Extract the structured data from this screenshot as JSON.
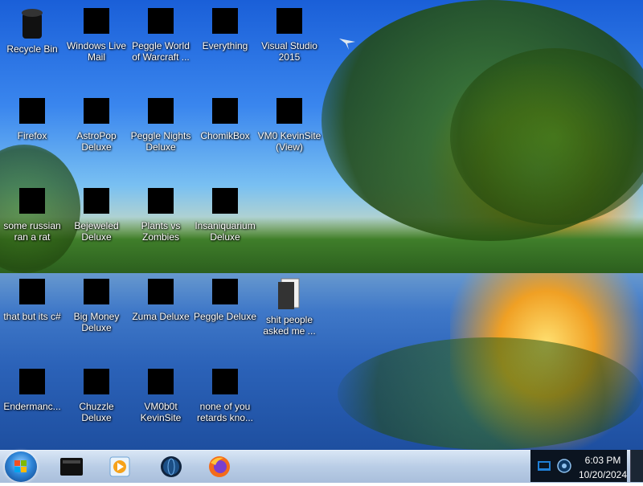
{
  "desktop": {
    "icons": [
      {
        "label": "Recycle Bin",
        "icon": "recycle-bin-icon"
      },
      {
        "label": "Windows Live\nMail",
        "icon": "mail-icon"
      },
      {
        "label": "Peggle World\nof Warcraft ...",
        "icon": "peggle-icon"
      },
      {
        "label": "Everything",
        "icon": "search-app-icon"
      },
      {
        "label": "Visual Studio\n2015",
        "icon": "visual-studio-icon"
      },
      {
        "label": "Firefox",
        "icon": "firefox-icon"
      },
      {
        "label": "AstroPop\nDeluxe",
        "icon": "game-icon"
      },
      {
        "label": "Peggle Nights\nDeluxe",
        "icon": "peggle-icon"
      },
      {
        "label": "ChomikBox",
        "icon": "chomikbox-icon"
      },
      {
        "label": "VM0 KevinSite\n(View)",
        "icon": "document-icon"
      },
      {
        "label": "some russian\nran a rat",
        "icon": "app-icon"
      },
      {
        "label": "Bejeweled\nDeluxe",
        "icon": "gem-icon"
      },
      {
        "label": "Plants vs\nZombies",
        "icon": "plant-icon"
      },
      {
        "label": "Insaniquarium\nDeluxe",
        "icon": "fish-icon"
      },
      {
        "label": "that but its c#",
        "icon": "files-icon"
      },
      {
        "label": "Big Money\nDeluxe",
        "icon": "money-icon"
      },
      {
        "label": "Zuma Deluxe",
        "icon": "zuma-icon"
      },
      {
        "label": "Peggle Deluxe",
        "icon": "peggle-icon"
      },
      {
        "label": "shit people\nasked me ...",
        "icon": "folder-icon"
      },
      {
        "label": "Endermanc...",
        "icon": "app-icon"
      },
      {
        "label": "Chuzzle\nDeluxe",
        "icon": "chuzzle-icon"
      },
      {
        "label": "VM0b0t\nKevinSite",
        "icon": "monitor-icon"
      },
      {
        "label": "none of you\nretards kno...",
        "icon": "firefox-icon"
      }
    ]
  },
  "taskbar": {
    "start_icon": "windows-start-icon",
    "pinned": [
      {
        "name": "file-explorer-icon"
      },
      {
        "name": "media-player-icon"
      },
      {
        "name": "network-globe-icon"
      },
      {
        "name": "firefox-icon"
      }
    ],
    "tray": {
      "time": "6:03 PM",
      "date": "10/20/2024"
    }
  }
}
